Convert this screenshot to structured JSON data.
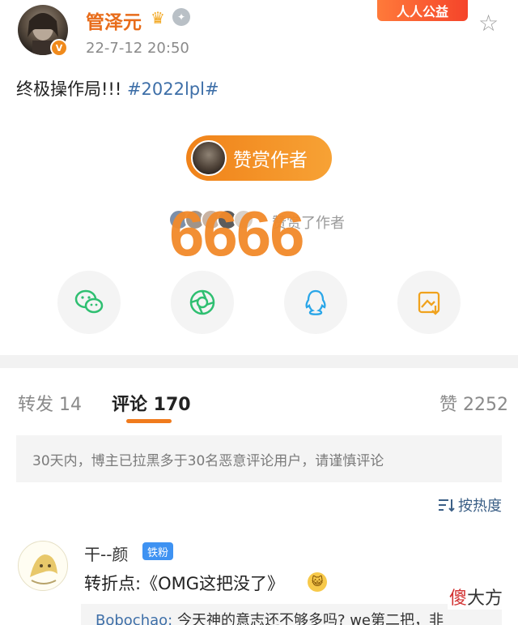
{
  "header": {
    "username": "管泽元",
    "timestamp": "22-7-12 20:50",
    "charity_label": "人人公益",
    "verified_mark": "V"
  },
  "post": {
    "text": "终极操作局!!! ",
    "hashtag": "#2022lpl#"
  },
  "reward": {
    "button_label": "赞赏作者",
    "supporters_text": "赞赏了作者",
    "overlay_number": "6666"
  },
  "share_icons": [
    "wechat-icon",
    "moments-icon",
    "qq-icon",
    "save-image-icon"
  ],
  "tabs": {
    "repost": "转发 14",
    "comment": "评论 170",
    "like": "赞 2252"
  },
  "notice": "30天内，博主已拉黑多于30名恶意评论用户，请谨慎评论",
  "sort_label": "按热度",
  "comment": {
    "name": "干--颜",
    "badge": "铁粉",
    "text": "转折点:《OMG这把没了》",
    "reply_name": "Bobochao:",
    "reply_text": " 今天神的意志还不够多吗? we第二把，非"
  },
  "watermark": {
    "red": "傻",
    "rest": "大方"
  },
  "colors": {
    "accent": "#f07b1d",
    "link": "#3e6fa8",
    "username": "#e86c1a"
  }
}
